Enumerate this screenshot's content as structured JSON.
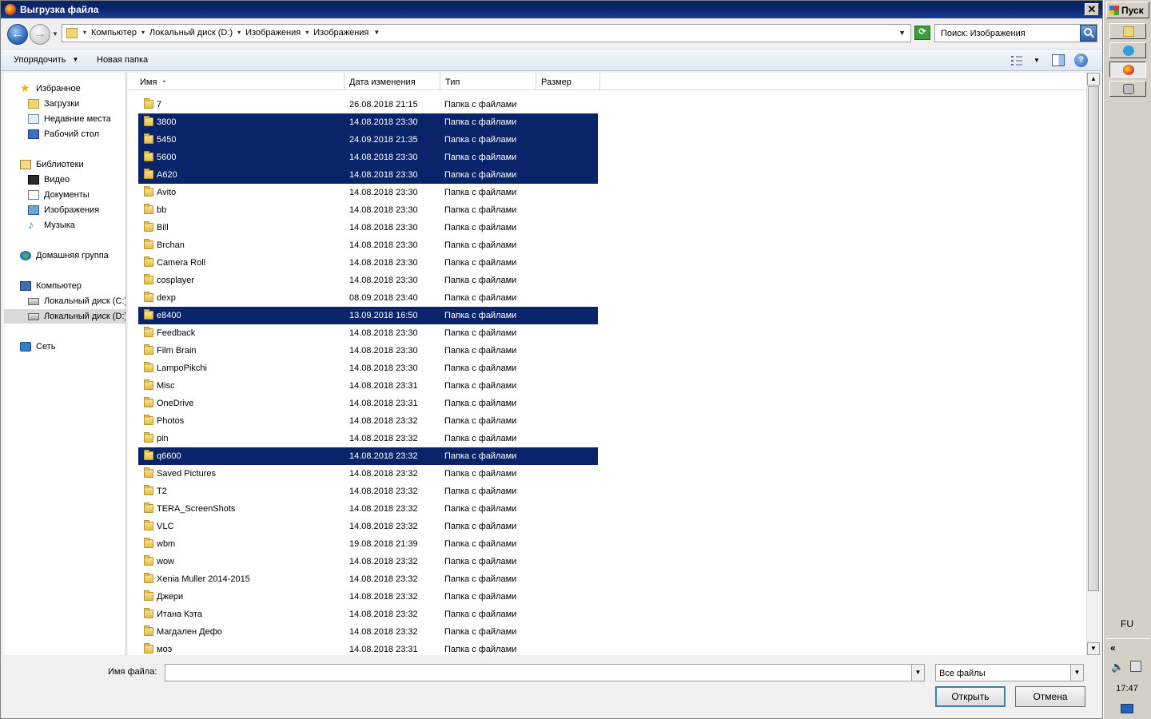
{
  "window": {
    "title": "Выгрузка файла",
    "close_label": "✕"
  },
  "address": {
    "crumbs": [
      "Компьютер",
      "Локальный диск (D:)",
      "Изображения",
      "Изображения"
    ],
    "search_text": "Поиск: Изображения"
  },
  "toolbar": {
    "organize_label": "Упорядочить",
    "new_folder_label": "Новая папка",
    "help_label": "?"
  },
  "nav": {
    "items": [
      {
        "label": "Избранное",
        "icon": "star-icon",
        "level": 0,
        "selected": false
      },
      {
        "label": "Загрузки",
        "icon": "downloads-folder-icon",
        "level": 1,
        "selected": false
      },
      {
        "label": "Недавние места",
        "icon": "recent-places-icon",
        "level": 1,
        "selected": false
      },
      {
        "label": "Рабочий стол",
        "icon": "desktop-icon",
        "level": 1,
        "selected": false
      },
      {
        "label": "Библиотеки",
        "icon": "libraries-icon",
        "level": 0,
        "selected": false
      },
      {
        "label": "Видео",
        "icon": "video-library-icon",
        "level": 1,
        "selected": false
      },
      {
        "label": "Документы",
        "icon": "documents-library-icon",
        "level": 1,
        "selected": false
      },
      {
        "label": "Изображения",
        "icon": "pictures-library-icon",
        "level": 1,
        "selected": false
      },
      {
        "label": "Музыка",
        "icon": "music-library-icon",
        "level": 1,
        "selected": false
      },
      {
        "label": "Домашняя группа",
        "icon": "homegroup-icon",
        "level": 0,
        "selected": false
      },
      {
        "label": "Компьютер",
        "icon": "computer-icon",
        "level": 0,
        "selected": false
      },
      {
        "label": "Локальный диск (C:)",
        "icon": "local-disk-c-icon",
        "level": 1,
        "selected": false
      },
      {
        "label": "Локальный диск (D:)",
        "icon": "local-disk-d-icon",
        "level": 1,
        "selected": true
      },
      {
        "label": "Сеть",
        "icon": "network-icon",
        "level": 0,
        "selected": false
      }
    ]
  },
  "columns": {
    "name": "Имя",
    "date": "Дата изменения",
    "type": "Тип",
    "size": "Размер"
  },
  "files": [
    {
      "name": "7",
      "date": "26.08.2018 21:15",
      "type": "Папка с файлами",
      "selected": false
    },
    {
      "name": "3800",
      "date": "14.08.2018 23:30",
      "type": "Папка с файлами",
      "selected": true
    },
    {
      "name": "5450",
      "date": "24.09.2018 21:35",
      "type": "Папка с файлами",
      "selected": true
    },
    {
      "name": "5600",
      "date": "14.08.2018 23:30",
      "type": "Папка с файлами",
      "selected": true
    },
    {
      "name": "A620",
      "date": "14.08.2018 23:30",
      "type": "Папка с файлами",
      "selected": true
    },
    {
      "name": "Avito",
      "date": "14.08.2018 23:30",
      "type": "Папка с файлами",
      "selected": false
    },
    {
      "name": "bb",
      "date": "14.08.2018 23:30",
      "type": "Папка с файлами",
      "selected": false
    },
    {
      "name": "Bill",
      "date": "14.08.2018 23:30",
      "type": "Папка с файлами",
      "selected": false
    },
    {
      "name": "Brchan",
      "date": "14.08.2018 23:30",
      "type": "Папка с файлами",
      "selected": false
    },
    {
      "name": "Camera Roll",
      "date": "14.08.2018 23:30",
      "type": "Папка с файлами",
      "selected": false
    },
    {
      "name": "cosplayer",
      "date": "14.08.2018 23:30",
      "type": "Папка с файлами",
      "selected": false
    },
    {
      "name": "dexp",
      "date": "08.09.2018 23:40",
      "type": "Папка с файлами",
      "selected": false
    },
    {
      "name": "e8400",
      "date": "13.09.2018 16:50",
      "type": "Папка с файлами",
      "selected": true
    },
    {
      "name": "Feedback",
      "date": "14.08.2018 23:30",
      "type": "Папка с файлами",
      "selected": false
    },
    {
      "name": "Film Brain",
      "date": "14.08.2018 23:30",
      "type": "Папка с файлами",
      "selected": false
    },
    {
      "name": "LampoPikchi",
      "date": "14.08.2018 23:30",
      "type": "Папка с файлами",
      "selected": false
    },
    {
      "name": "Misc",
      "date": "14.08.2018 23:31",
      "type": "Папка с файлами",
      "selected": false
    },
    {
      "name": "OneDrive",
      "date": "14.08.2018 23:31",
      "type": "Папка с файлами",
      "selected": false
    },
    {
      "name": "Photos",
      "date": "14.08.2018 23:32",
      "type": "Папка с файлами",
      "selected": false
    },
    {
      "name": "pin",
      "date": "14.08.2018 23:32",
      "type": "Папка с файлами",
      "selected": false
    },
    {
      "name": "q6600",
      "date": "14.08.2018 23:32",
      "type": "Папка с файлами",
      "selected": true
    },
    {
      "name": "Saved Pictures",
      "date": "14.08.2018 23:32",
      "type": "Папка с файлами",
      "selected": false
    },
    {
      "name": "T2",
      "date": "14.08.2018 23:32",
      "type": "Папка с файлами",
      "selected": false
    },
    {
      "name": "TERA_ScreenShots",
      "date": "14.08.2018 23:32",
      "type": "Папка с файлами",
      "selected": false
    },
    {
      "name": "VLC",
      "date": "14.08.2018 23:32",
      "type": "Папка с файлами",
      "selected": false
    },
    {
      "name": "wbm",
      "date": "19.08.2018 21:39",
      "type": "Папка с файлами",
      "selected": false
    },
    {
      "name": "wow",
      "date": "14.08.2018 23:32",
      "type": "Папка с файлами",
      "selected": false
    },
    {
      "name": "Xenia Muller 2014-2015",
      "date": "14.08.2018 23:32",
      "type": "Папка с файлами",
      "selected": false
    },
    {
      "name": "Джери",
      "date": "14.08.2018 23:32",
      "type": "Папка с файлами",
      "selected": false
    },
    {
      "name": "Итана Кэта",
      "date": "14.08.2018 23:32",
      "type": "Папка с файлами",
      "selected": false
    },
    {
      "name": "Магдален Дефо",
      "date": "14.08.2018 23:32",
      "type": "Папка с файлами",
      "selected": false
    },
    {
      "name": "моэ",
      "date": "14.08.2018 23:31",
      "type": "Папка с файлами",
      "selected": false
    }
  ],
  "bottom": {
    "filename_label": "Имя файла:",
    "filename_value": "",
    "filetype_value": "Все файлы",
    "open_label": "Открыть",
    "cancel_label": "Отмена"
  },
  "taskbar": {
    "start_label": "Пуск",
    "buttons": [
      "explorer-icon",
      "telegram-icon",
      "firefox-icon",
      "key-icon"
    ],
    "active_button": 2,
    "language": "FU",
    "expand_label": "«",
    "clock": "17:47"
  },
  "colors": {
    "selection": "#0a246a",
    "titlebar": "#0a246a",
    "nav_selected": "#d9d9d9"
  }
}
